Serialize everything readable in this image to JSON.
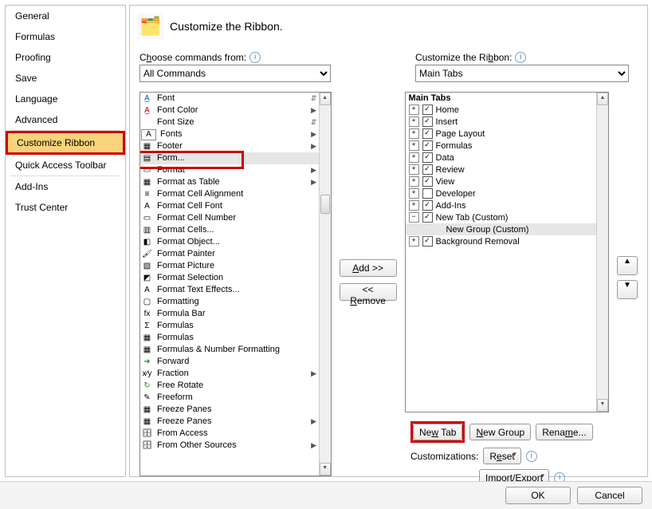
{
  "title": "Customize the Ribbon.",
  "sidebar": {
    "items": [
      {
        "label": "General"
      },
      {
        "label": "Formulas"
      },
      {
        "label": "Proofing"
      },
      {
        "label": "Save"
      },
      {
        "label": "Language"
      },
      {
        "label": "Advanced"
      },
      {
        "label": "Customize Ribbon"
      },
      {
        "label": "Quick Access Toolbar"
      },
      {
        "label": "Add-Ins"
      },
      {
        "label": "Trust Center"
      }
    ]
  },
  "choose": {
    "label_pre": "C",
    "label_u": "h",
    "label_post": "oose commands from:",
    "value": "All Commands"
  },
  "customize": {
    "label_pre": "Customize the Ri",
    "label_u": "b",
    "label_post": "bon:",
    "value": "Main Tabs"
  },
  "commands": [
    {
      "name": "Font",
      "icon": "A̲",
      "arrow": "⇵",
      "color": "#1a4ea0"
    },
    {
      "name": "Font Color",
      "icon": "A̲",
      "arrow": "▶",
      "color": "#c00000"
    },
    {
      "name": "Font Size",
      "icon": "",
      "arrow": "⇵"
    },
    {
      "name": "Fonts",
      "icon": "A",
      "arrow": "▶",
      "box": true
    },
    {
      "name": "Footer",
      "icon": "▦",
      "arrow": "▶"
    },
    {
      "name": "Form...",
      "icon": "▤",
      "arrow": "",
      "sel": true,
      "outline": true
    },
    {
      "name": "Format",
      "icon": "▭",
      "arrow": "▶"
    },
    {
      "name": "Format as Table",
      "icon": "▦",
      "arrow": "▶"
    },
    {
      "name": "Format Cell Alignment",
      "icon": "≡"
    },
    {
      "name": "Format Cell Font",
      "icon": "A"
    },
    {
      "name": "Format Cell Number",
      "icon": "▭"
    },
    {
      "name": "Format Cells...",
      "icon": "▥"
    },
    {
      "name": "Format Object...",
      "icon": "◧"
    },
    {
      "name": "Format Painter",
      "icon": "🖌"
    },
    {
      "name": "Format Picture",
      "icon": "▧"
    },
    {
      "name": "Format Selection",
      "icon": "◩"
    },
    {
      "name": "Format Text Effects...",
      "icon": "A"
    },
    {
      "name": "Formatting",
      "icon": "▢"
    },
    {
      "name": "Formula Bar",
      "icon": "fx"
    },
    {
      "name": "Formulas",
      "icon": "Σ"
    },
    {
      "name": "Formulas",
      "icon": "▦"
    },
    {
      "name": "Formulas & Number Formatting",
      "icon": "▦"
    },
    {
      "name": "Forward",
      "icon": "➜",
      "color": "#2a8a2a"
    },
    {
      "name": "Fraction",
      "icon": "x⁄y",
      "arrow": "▶"
    },
    {
      "name": "Free Rotate",
      "icon": "↻",
      "color": "#2a8a2a"
    },
    {
      "name": "Freeform",
      "icon": "✎"
    },
    {
      "name": "Freeze Panes",
      "icon": "▦"
    },
    {
      "name": "Freeze Panes",
      "icon": "▦",
      "arrow": "▶"
    },
    {
      "name": "From Access",
      "icon": "🗄"
    },
    {
      "name": "From Other Sources",
      "icon": "🗄",
      "arrow": "▶"
    }
  ],
  "mid": {
    "add_pre": "",
    "add_u": "A",
    "add_post": "dd >>",
    "rem_pre": "<< ",
    "rem_u": "R",
    "rem_post": "emove"
  },
  "tree": {
    "header": "Main Tabs",
    "items": [
      {
        "exp": "+",
        "chk": true,
        "label": "Home",
        "indent": 0
      },
      {
        "exp": "+",
        "chk": true,
        "label": "Insert",
        "indent": 0
      },
      {
        "exp": "+",
        "chk": true,
        "label": "Page Layout",
        "indent": 0
      },
      {
        "exp": "+",
        "chk": true,
        "label": "Formulas",
        "indent": 0
      },
      {
        "exp": "+",
        "chk": true,
        "label": "Data",
        "indent": 0
      },
      {
        "exp": "+",
        "chk": true,
        "label": "Review",
        "indent": 0
      },
      {
        "exp": "+",
        "chk": true,
        "label": "View",
        "indent": 0
      },
      {
        "exp": "+",
        "chk": false,
        "label": "Developer",
        "indent": 0
      },
      {
        "exp": "+",
        "chk": true,
        "label": "Add-Ins",
        "indent": 0
      },
      {
        "exp": "−",
        "chk": true,
        "label": "New Tab (Custom)",
        "indent": 0
      },
      {
        "exp": "",
        "chk": null,
        "label": "New Group (Custom)",
        "indent": 2,
        "sel": true
      },
      {
        "exp": "+",
        "chk": true,
        "label": "Background Removal",
        "indent": 0
      }
    ]
  },
  "below": {
    "newtab_pre": "Ne",
    "newtab_u": "w",
    "newtab_post": " Tab",
    "newgroup_pre": "",
    "newgroup_u": "N",
    "newgroup_post": "ew Group",
    "rename_pre": "Rena",
    "rename_u": "m",
    "rename_post": "e...",
    "customizations": "Customizations:",
    "reset_pre": "R",
    "reset_u": "e",
    "reset_post": "set",
    "imp_pre": "Import/Ex",
    "imp_u": "p",
    "imp_post": "ort"
  },
  "footer": {
    "ok": "OK",
    "cancel": "Cancel"
  }
}
